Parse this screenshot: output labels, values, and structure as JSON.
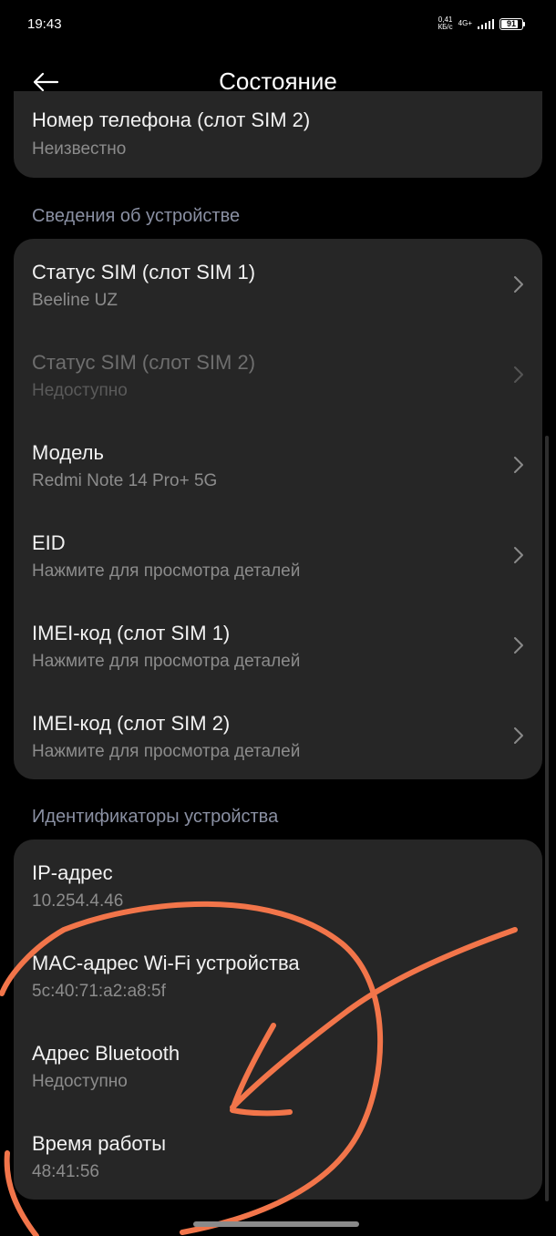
{
  "status_bar": {
    "time": "19:43",
    "net_speed_value": "0,41",
    "net_speed_unit": "КБ/с",
    "network_type": "4G+",
    "battery_level": "91"
  },
  "header": {
    "title": "Состояние"
  },
  "top_card": {
    "phone_sim2_title": "Номер телефона (слот SIM 2)",
    "phone_sim2_value": "Неизвестно"
  },
  "device_info": {
    "header": "Сведения об устройстве",
    "items": [
      {
        "title": "Статус SIM (слот SIM 1)",
        "subtitle": "Beeline UZ"
      },
      {
        "title": "Статус SIM (слот SIM 2)",
        "subtitle": "Недоступно"
      },
      {
        "title": "Модель",
        "subtitle": "Redmi Note 14 Pro+ 5G"
      },
      {
        "title": "EID",
        "subtitle": "Нажмите для просмотра деталей"
      },
      {
        "title": "IMEI-код (слот SIM 1)",
        "subtitle": "Нажмите для просмотра деталей"
      },
      {
        "title": "IMEI-код (слот SIM 2)",
        "subtitle": "Нажмите для просмотра деталей"
      }
    ]
  },
  "device_ids": {
    "header": "Идентификаторы устройства",
    "items": [
      {
        "title": "IP-адрес",
        "value": "10.254.4.46"
      },
      {
        "title": "MAC-адрес Wi-Fi устройства",
        "value": "5c:40:71:a2:a8:5f"
      },
      {
        "title": "Адрес Bluetooth",
        "value": "Недоступно"
      },
      {
        "title": "Время работы",
        "value": "48:41:56"
      }
    ]
  },
  "colors": {
    "background": "#000000",
    "card": "#262626",
    "section_header": "#8a90a3",
    "annotation": "#f2754a"
  },
  "icons": {
    "back": "arrow-left-icon",
    "chevron": "chevron-right-icon"
  }
}
